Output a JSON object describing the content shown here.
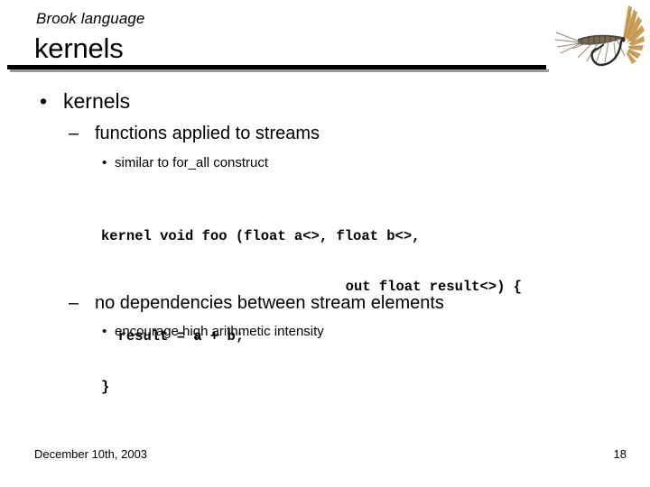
{
  "slide": {
    "kicker": "Brook language",
    "title": "kernels",
    "accent_color": "#000000",
    "background_color": "#ffffff",
    "rule_shadow_color": "#9a9a9a"
  },
  "artwork": {
    "name": "fishing-fly-image",
    "description": "dry fly fishing lure",
    "hackle_color": "#c99a52",
    "body_color": "#5d5c57",
    "hook_color": "#2b2b2b",
    "leg_color": "#8a7a5e"
  },
  "bullets": [
    {
      "level": 1,
      "marker": "•",
      "text": "kernels"
    },
    {
      "level": 2,
      "marker": "–",
      "text": "functions applied to streams"
    },
    {
      "level": 3,
      "marker": "•",
      "text": "similar to for_all construct"
    },
    {
      "level": 2,
      "marker": "–",
      "text": "no dependencies between stream elements"
    },
    {
      "level": 3,
      "marker": "•",
      "text": "encourage high arithmetic intensity"
    }
  ],
  "code": {
    "language": "brook",
    "lines": [
      "kernel void foo (float a<>, float b<>,",
      "out float result<>) {",
      "  result = a + b;",
      "}"
    ]
  },
  "footer": {
    "date": "December 10th, 2003",
    "page_number": "18"
  }
}
